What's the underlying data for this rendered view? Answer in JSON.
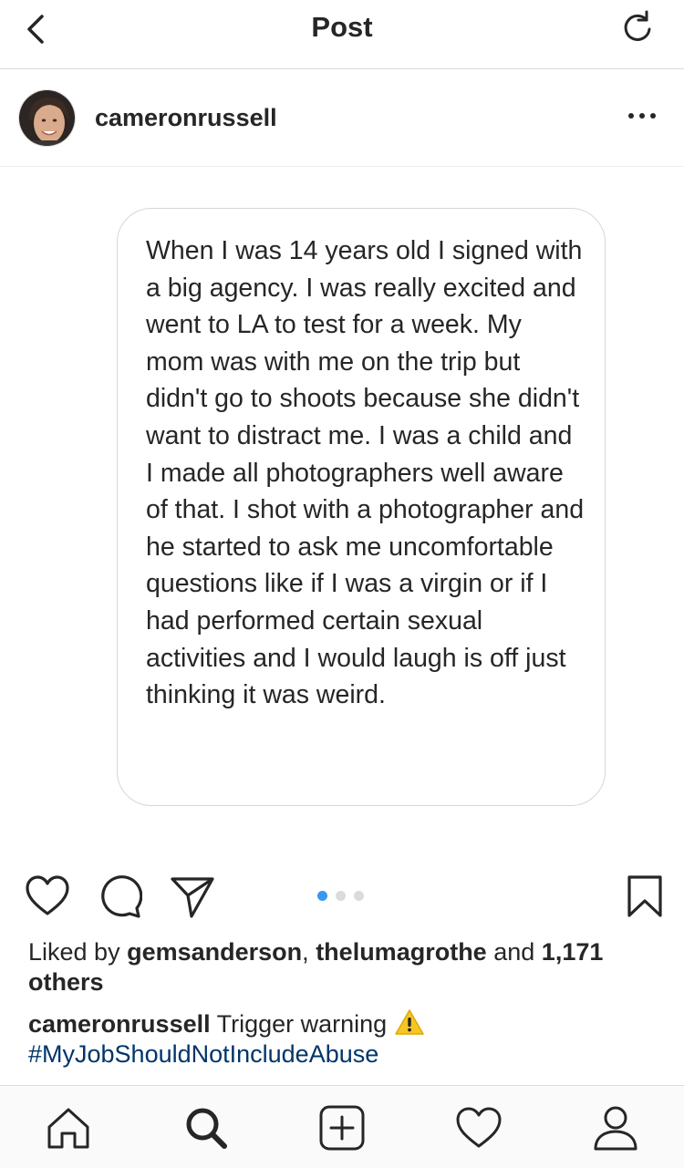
{
  "topbar": {
    "title": "Post",
    "back_icon": "chevron-left-icon",
    "refresh_icon": "refresh-icon"
  },
  "post": {
    "username": "cameronrussell",
    "avatar_icon": "profile-photo",
    "more_icon": "more-options-icon",
    "image_text": "When I was 14 years old I signed with a big agency. I was really excited and went to LA to test for a week. My mom was with me on the trip but didn't go to shoots because she didn't want to distract me. I was a child and I made all photographers well aware of that. I shot with a photographer and he started to ask me uncomfortable questions like if I was a virgin or if I had performed certain sexual activities and I would laugh is off just thinking it was weird.",
    "carousel": {
      "count": 3,
      "active_index": 0
    }
  },
  "actions": {
    "like_icon": "heart-icon",
    "comment_icon": "comment-icon",
    "share_icon": "send-icon",
    "save_icon": "bookmark-icon"
  },
  "likes": {
    "prefix": "Liked by",
    "user1": "gemsanderson",
    "separator": ",",
    "user2": "thelumagrothe",
    "and": "and",
    "count": "1,171",
    "suffix": "others"
  },
  "caption": {
    "username": "cameronrussell",
    "text": "Trigger warning",
    "emoji_icon": "warning-icon",
    "hashtag": "#MyJobShouldNotIncludeAbuse"
  },
  "colors": {
    "accent": "#3897f0",
    "hashtag": "#003569",
    "text": "#262626",
    "border": "#dbdbdb"
  },
  "bottom_nav": [
    "home-icon",
    "search-icon",
    "add-post-icon",
    "activity-heart-icon",
    "profile-icon"
  ]
}
